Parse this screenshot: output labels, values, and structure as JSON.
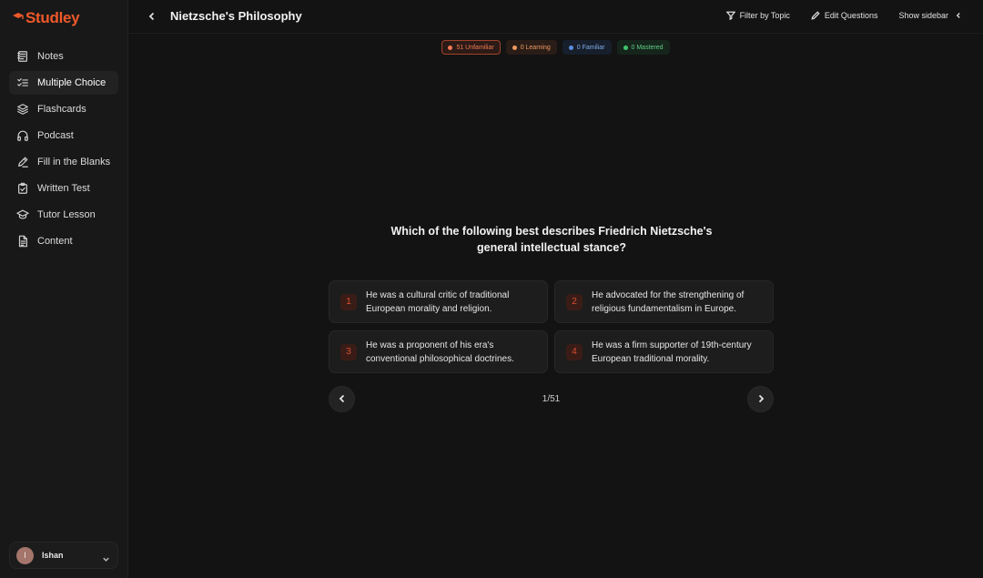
{
  "app": {
    "name": "Studley",
    "brand_color": "#f0582a"
  },
  "sidebar": {
    "items": [
      {
        "label": "Notes",
        "icon": "notes-icon"
      },
      {
        "label": "Multiple Choice",
        "icon": "checklist-icon",
        "active": true
      },
      {
        "label": "Flashcards",
        "icon": "layers-icon"
      },
      {
        "label": "Podcast",
        "icon": "headphones-icon"
      },
      {
        "label": "Fill in the Blanks",
        "icon": "pen-icon"
      },
      {
        "label": "Written Test",
        "icon": "clipboard-check-icon"
      },
      {
        "label": "Tutor Lesson",
        "icon": "graduation-cap-icon"
      },
      {
        "label": "Content",
        "icon": "document-icon"
      }
    ],
    "user": {
      "initial": "I",
      "name": "Ishan"
    }
  },
  "header": {
    "title": "Nietzsche's Philosophy",
    "filter_label": "Filter by Topic",
    "edit_label": "Edit Questions",
    "sidebar_label": "Show sidebar"
  },
  "badges": {
    "unfamiliar": "51 Unfamiliar",
    "learning": "0 Learning",
    "familiar": "0 Familiar",
    "mastered": "0 Mastered",
    "colors": {
      "unfamiliar": "#f07a55",
      "learning": "#f09a62",
      "familiar": "#5b8fe0",
      "mastered": "#3fc56a"
    }
  },
  "question": {
    "text": "Which of the following best describes Friedrich Nietzsche's general intellectual stance?",
    "options": [
      {
        "num": "1",
        "text": "He was a cultural critic of traditional European morality and religion."
      },
      {
        "num": "2",
        "text": "He advocated for the strengthening of religious fundamentalism in Europe."
      },
      {
        "num": "3",
        "text": "He was a proponent of his era's conventional philosophical doctrines."
      },
      {
        "num": "4",
        "text": "He was a firm supporter of 19th-century European traditional morality."
      }
    ]
  },
  "pager": {
    "progress": "1/51"
  }
}
